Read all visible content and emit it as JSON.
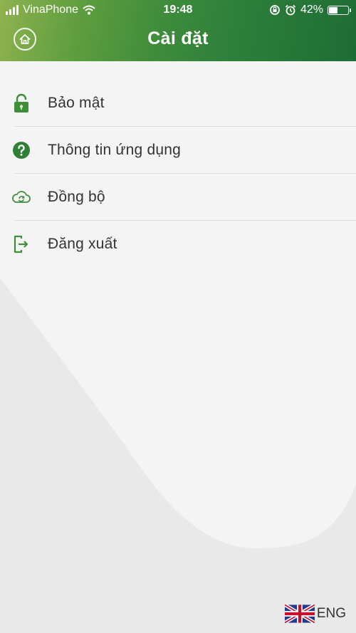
{
  "status_bar": {
    "carrier": "VinaPhone",
    "time": "19:48",
    "battery_percent": "42%",
    "battery_level": 0.42
  },
  "header": {
    "title": "Cài đặt",
    "home_icon": "home-icon"
  },
  "menu": {
    "items": [
      {
        "label": "Bảo mật",
        "icon": "lock-icon"
      },
      {
        "label": "Thông tin ứng dụng",
        "icon": "help-icon"
      },
      {
        "label": "Đồng bộ",
        "icon": "cloud-sync-icon"
      },
      {
        "label": "Đăng xuất",
        "icon": "logout-icon"
      }
    ]
  },
  "language": {
    "label": "ENG",
    "flag": "uk-flag-icon"
  },
  "colors": {
    "accent_green": "#2e7f3b",
    "header_gradient_start": "#8fb24f",
    "header_gradient_end": "#1e6c35",
    "background": "#e9e9e9",
    "panel": "#f3f3f3"
  }
}
